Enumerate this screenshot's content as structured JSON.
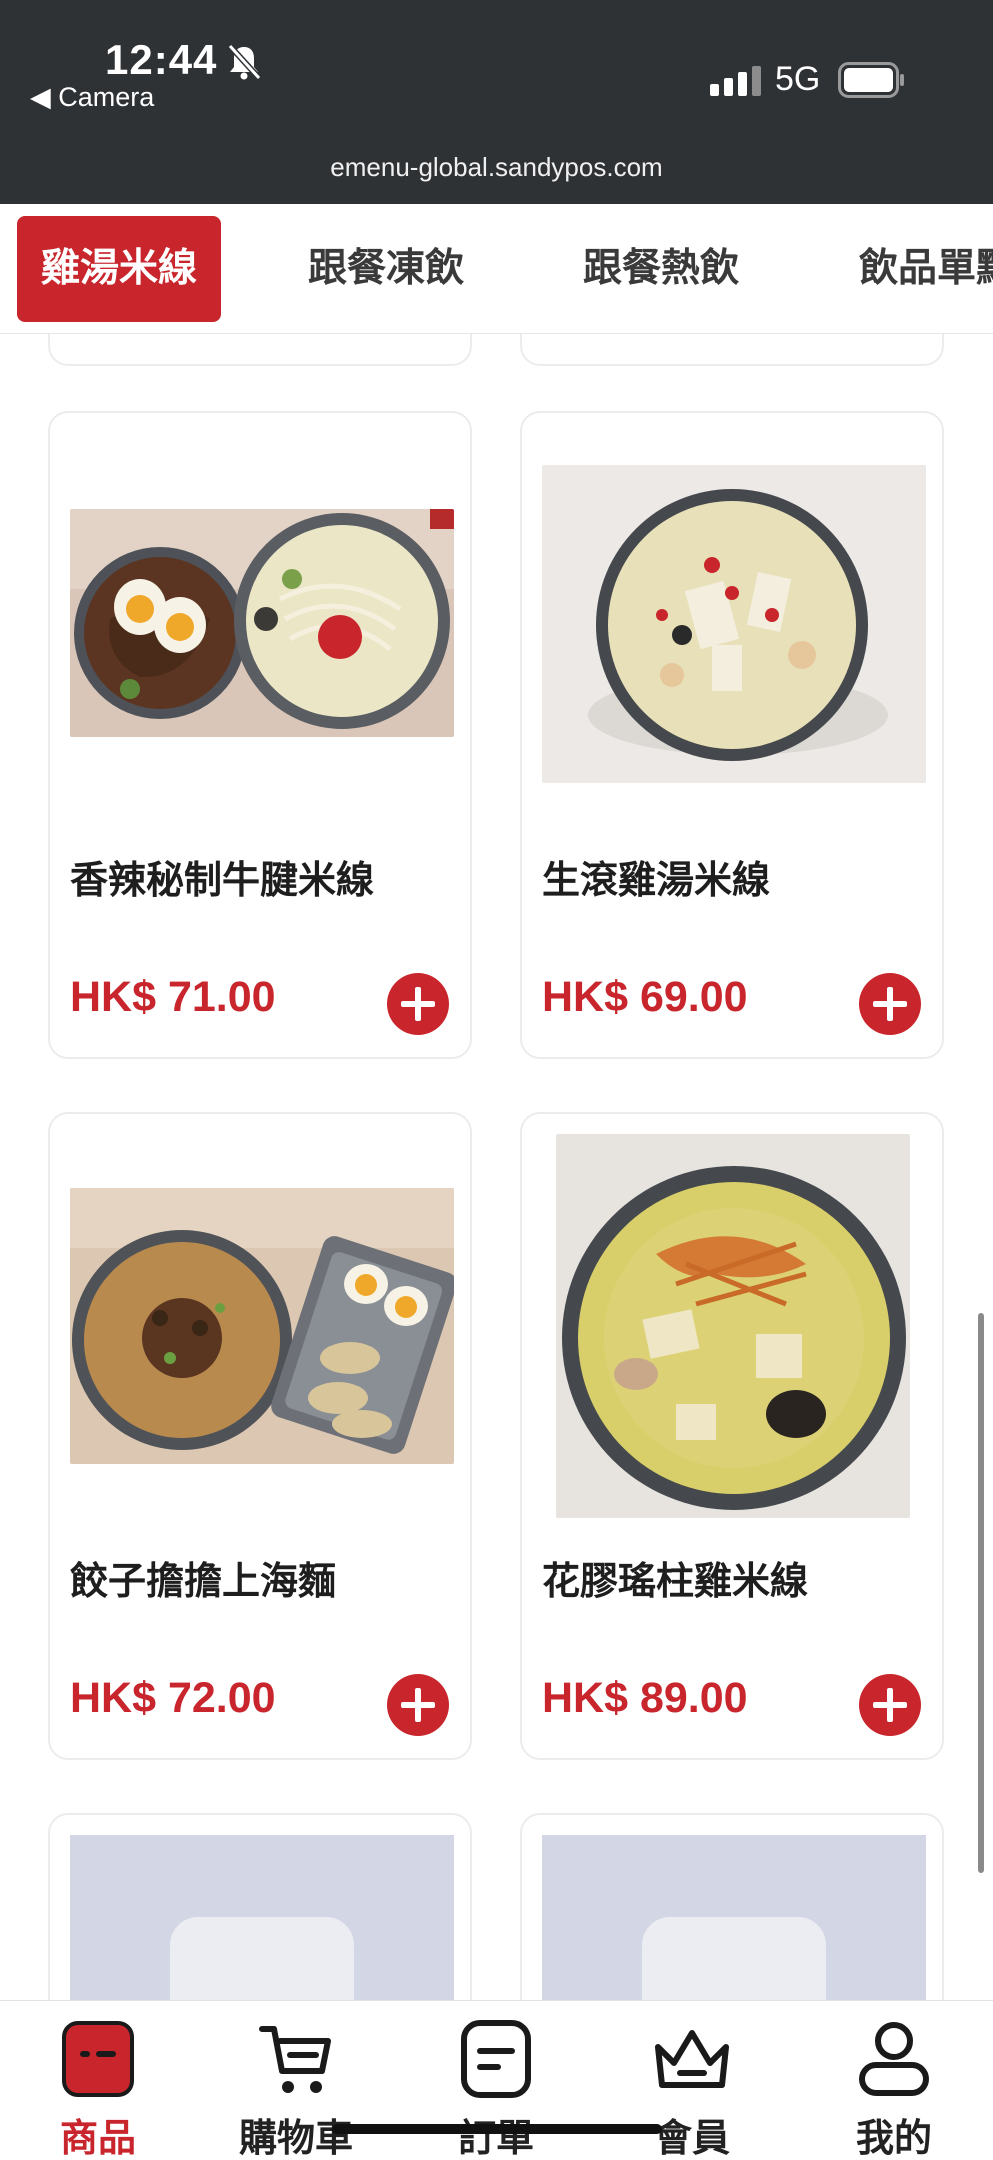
{
  "status_bar": {
    "time": "12:44",
    "back_label": "◀ Camera",
    "network": "5G",
    "url": "emenu-global.sandypos.com"
  },
  "tabs": [
    {
      "label": "雞湯米線",
      "active": true
    },
    {
      "label": "跟餐凍飲",
      "active": false
    },
    {
      "label": "跟餐熱飲",
      "active": false
    },
    {
      "label": "飲品單點",
      "active": false
    }
  ],
  "products": [
    {
      "name": "香辣秘制牛腱米線",
      "price": "HK$ 71.00"
    },
    {
      "name": "生滾雞湯米線",
      "price": "HK$ 69.00"
    },
    {
      "name": "餃子擔擔上海麵",
      "price": "HK$ 72.00"
    },
    {
      "name": "花膠瑤柱雞米線",
      "price": "HK$ 89.00"
    }
  ],
  "bottom_nav": [
    {
      "label": "商品",
      "icon": "product-bag-icon",
      "active": true
    },
    {
      "label": "購物車",
      "icon": "cart-icon",
      "active": false
    },
    {
      "label": "訂單",
      "icon": "order-icon",
      "active": false
    },
    {
      "label": "會員",
      "icon": "member-crown-icon",
      "active": false
    },
    {
      "label": "我的",
      "icon": "profile-icon",
      "active": false
    }
  ],
  "colors": {
    "accent": "#c8262c",
    "status_bar": "#2f3235"
  }
}
